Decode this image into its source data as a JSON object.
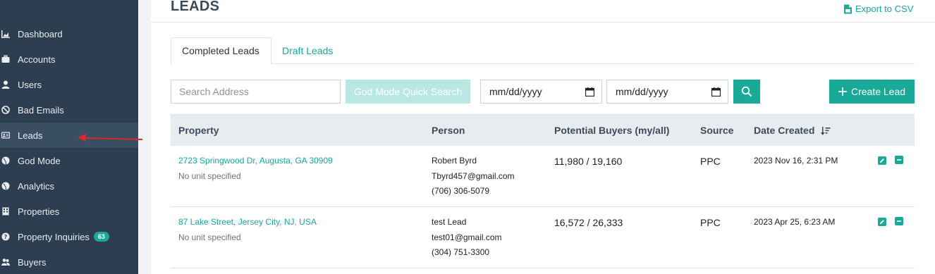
{
  "sidebar": {
    "items": [
      {
        "label": "Dashboard",
        "icon": "chart-area-icon"
      },
      {
        "label": "Accounts",
        "icon": "briefcase-icon"
      },
      {
        "label": "Users",
        "icon": "user-icon"
      },
      {
        "label": "Bad Emails",
        "icon": "ban-icon"
      },
      {
        "label": "Leads",
        "icon": "id-card-icon",
        "active": true
      },
      {
        "label": "God Mode",
        "icon": "globe-icon"
      },
      {
        "label": "Analytics",
        "icon": "globe-icon"
      },
      {
        "label": "Properties",
        "icon": "building-icon"
      },
      {
        "label": "Property Inquiries",
        "icon": "question-circle-icon",
        "badge": "63"
      },
      {
        "label": "Buyers",
        "icon": "users-icon"
      }
    ]
  },
  "page": {
    "title": "LEADS",
    "export_label": "Export to CSV"
  },
  "tabs": [
    {
      "label": "Completed Leads",
      "active": true
    },
    {
      "label": "Draft Leads"
    }
  ],
  "filters": {
    "search_placeholder": "Search Address",
    "search_value": "",
    "godmode_label": "God Mode Quick Search",
    "date_from": "mm/dd/yyyy",
    "date_to": "mm/dd/yyyy",
    "create_label": "Create Lead"
  },
  "table": {
    "columns": [
      "Property",
      "Person",
      "Potential Buyers (my/all)",
      "Source",
      "Date Created"
    ],
    "rows": [
      {
        "address": "2723 Springwood Dr, Augusta, GA 30909",
        "unit": "No unit specified",
        "name": "Robert Byrd",
        "email": "Tbyrd457@gmail.com",
        "phone": "(706) 306-5079",
        "buyers": "11,980 / 19,160",
        "source": "PPC",
        "date": "2023 Nov 16, 2:31 PM"
      },
      {
        "address": "87 Lake Street, Jersey City, NJ, USA",
        "unit": "No unit specified",
        "name": "test Lead",
        "email": "test01@gmail.com",
        "phone": "(304) 751-3300",
        "buyers": "16,572 / 26,333",
        "source": "PPC",
        "date": "2023 Apr 25, 6:23 AM"
      }
    ]
  },
  "colors": {
    "accent": "#18a999",
    "sidebar_bg": "#2d3e50",
    "annotation_arrow": "#e0242b"
  }
}
